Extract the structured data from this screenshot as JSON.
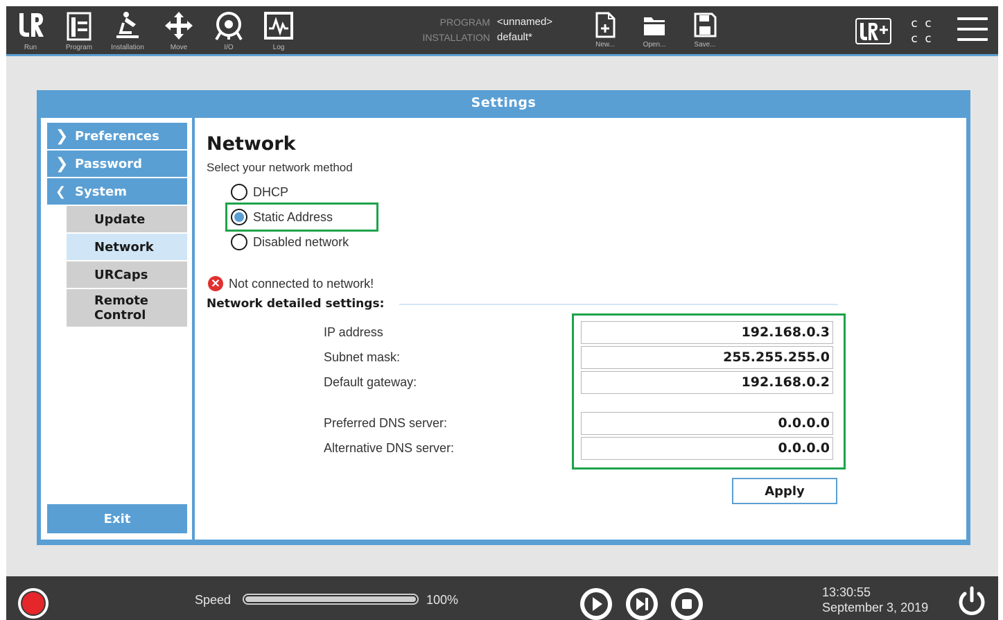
{
  "topbar": {
    "nav": [
      {
        "label": "Run",
        "icon": "ur-logo-icon"
      },
      {
        "label": "Program",
        "icon": "program-icon"
      },
      {
        "label": "Installation",
        "icon": "installation-icon"
      },
      {
        "label": "Move",
        "icon": "move-icon"
      },
      {
        "label": "I/O",
        "icon": "io-icon"
      },
      {
        "label": "Log",
        "icon": "log-icon"
      }
    ],
    "program_key": "PROGRAM",
    "program_val": "<unnamed>",
    "installation_key": "INSTALLATION",
    "installation_val": "default*",
    "file_buttons": [
      {
        "label": "New...",
        "icon": "new-file-icon"
      },
      {
        "label": "Open...",
        "icon": "open-folder-icon"
      },
      {
        "label": "Save...",
        "icon": "save-icon"
      }
    ],
    "urplus_icon": "urplus-icon",
    "cc_letters": [
      "c",
      "c",
      "c",
      "c"
    ],
    "menu_icon": "hamburger-icon"
  },
  "dialog": {
    "title": "Settings",
    "sidebar": {
      "items": [
        {
          "label": "Preferences",
          "expanded": false
        },
        {
          "label": "Password",
          "expanded": false
        },
        {
          "label": "System",
          "expanded": true
        }
      ],
      "sub_items": [
        "Update",
        "Network",
        "URCaps",
        "Remote Control"
      ],
      "active_sub": "Network",
      "exit_label": "Exit"
    },
    "network": {
      "title": "Network",
      "subtitle": "Select your network method",
      "methods": [
        "DHCP",
        "Static Address",
        "Disabled network"
      ],
      "selected_method": "Static Address",
      "status": "Not connected to network!",
      "details_heading": "Network detailed settings:",
      "fields": [
        {
          "label": "IP address",
          "value": "192.168.0.3"
        },
        {
          "label": "Subnet mask:",
          "value": "255.255.255.0"
        },
        {
          "label": "Default gateway:",
          "value": "192.168.0.2"
        },
        {
          "label": "Preferred DNS server:",
          "value": "0.0.0.0"
        },
        {
          "label": "Alternative DNS server:",
          "value": "0.0.0.0"
        }
      ],
      "apply_label": "Apply"
    }
  },
  "bottombar": {
    "speed_label": "Speed",
    "speed_value": "100%",
    "speed_fraction": 1.0,
    "time": "13:30:55",
    "date": "September 3, 2019",
    "colors": {
      "record": "#e5262a",
      "accent": "#5a9fd4",
      "highlight": "#1ea34a"
    }
  }
}
